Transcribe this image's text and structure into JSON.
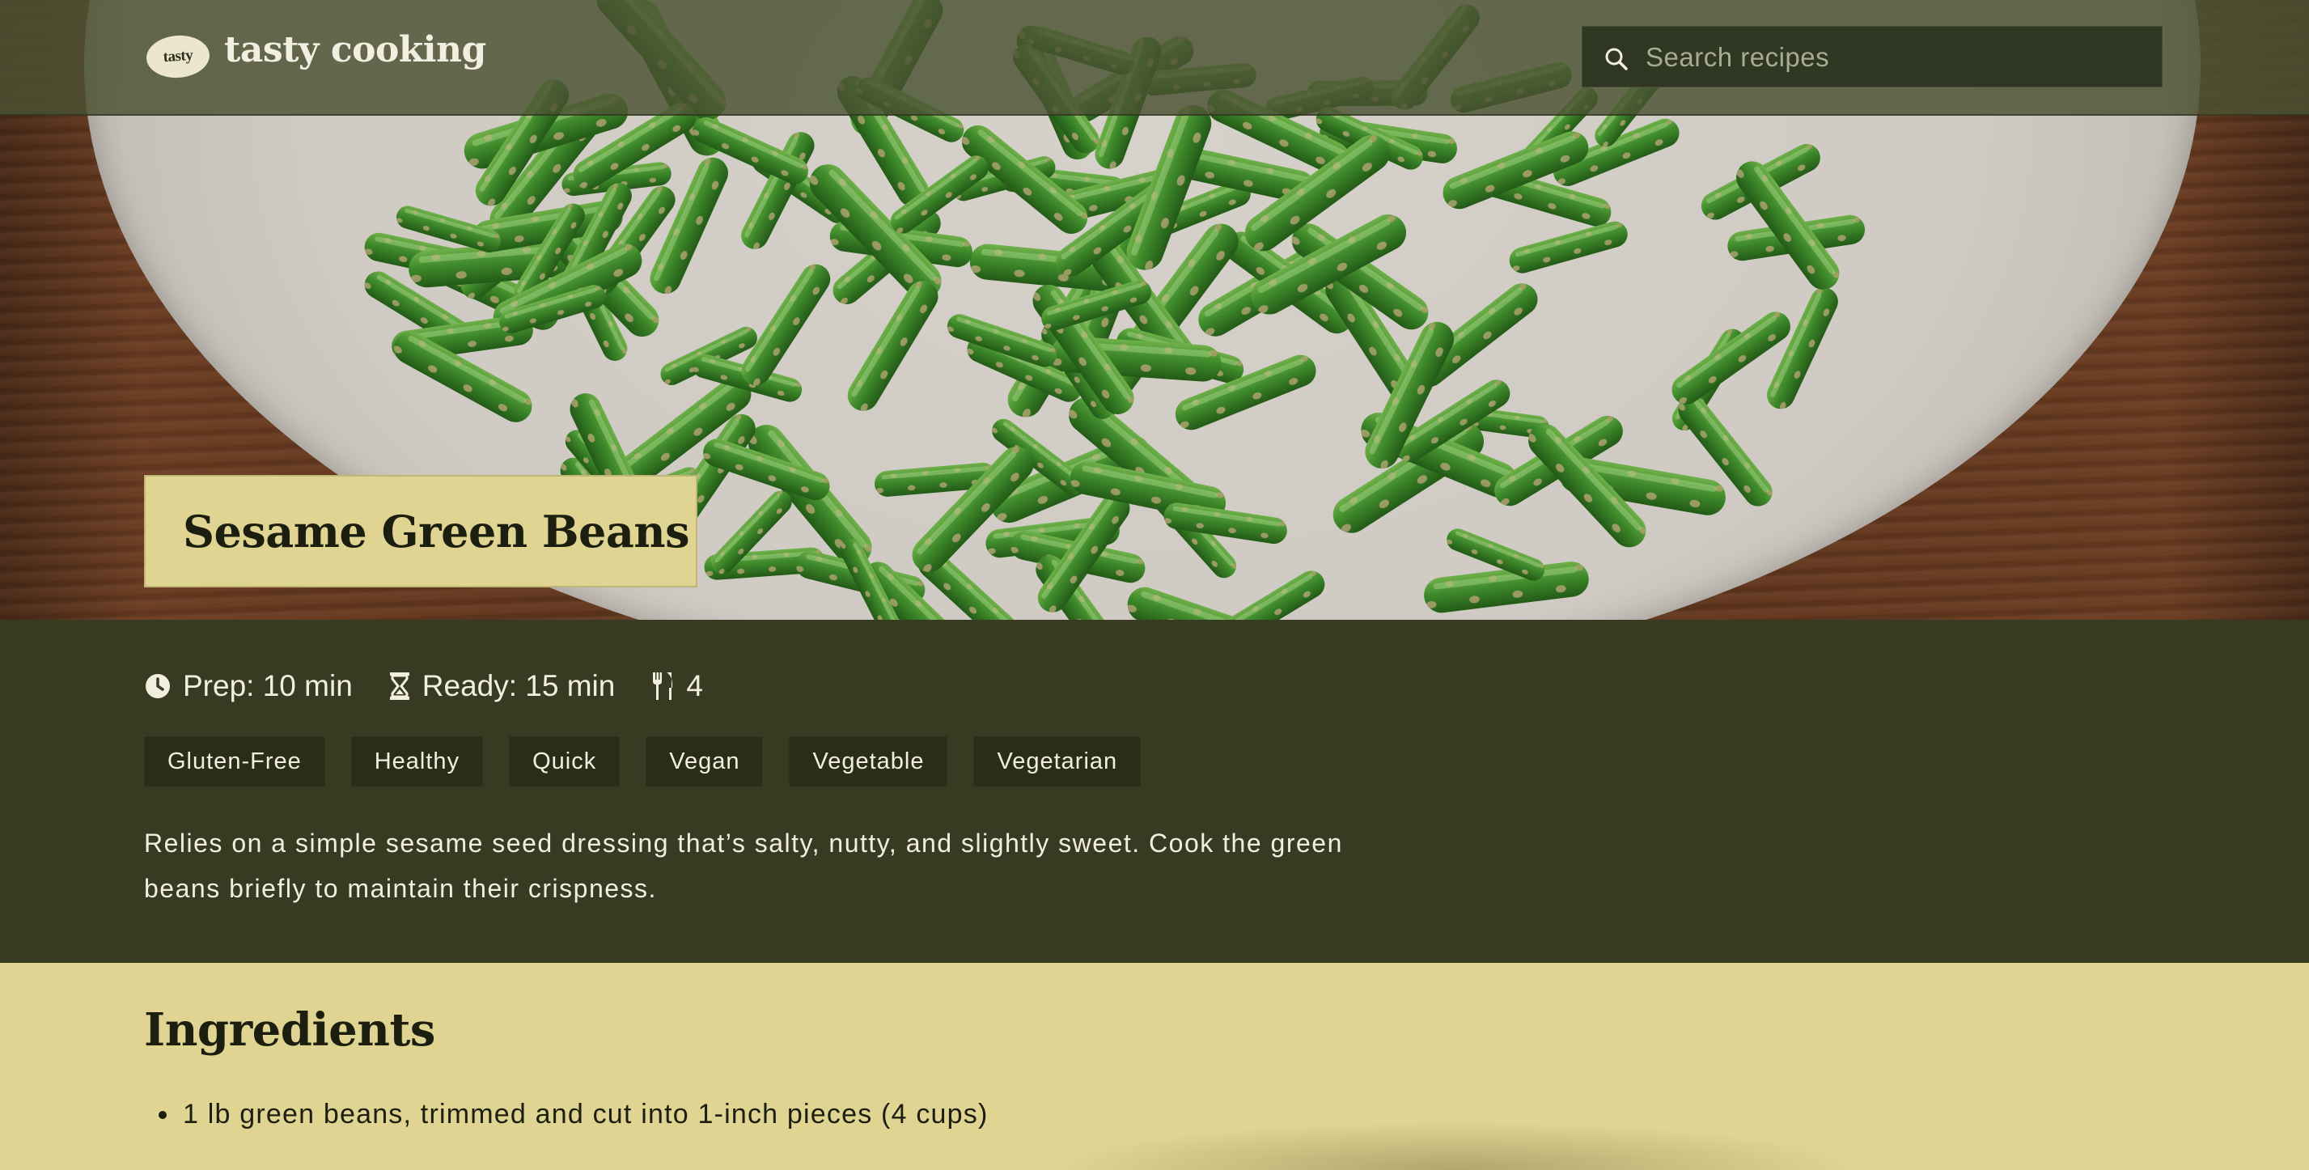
{
  "header": {
    "logo_badge": "tasty",
    "logo_text": "tasty cooking",
    "search_placeholder": "Search recipes"
  },
  "recipe": {
    "title": "Sesame Green Beans",
    "prep": "Prep: 10 min",
    "ready": "Ready: 15 min",
    "servings": "4",
    "tags": [
      "Gluten-Free",
      "Healthy",
      "Quick",
      "Vegan",
      "Vegetable",
      "Vegetarian"
    ],
    "description": "Relies on a simple sesame seed dressing that’s salty, nutty, and slightly sweet. Cook the green beans briefly to maintain their crispness."
  },
  "ingredients": {
    "heading": "Ingredients",
    "items": [
      "1 lb green beans, trimmed and cut into 1-inch pieces (4 cups)"
    ]
  },
  "icons": {
    "search": "search-icon",
    "prep": "clock-icon",
    "ready": "hourglass-icon",
    "servings": "fork-knife-icon"
  },
  "colors": {
    "header_bg": "#4a5232",
    "info_bg": "#373b22",
    "accent_yellow": "#e0d492",
    "tag_bg": "#2a2e19",
    "text_light": "#f3efe0",
    "text_dark": "#1c1f10"
  }
}
